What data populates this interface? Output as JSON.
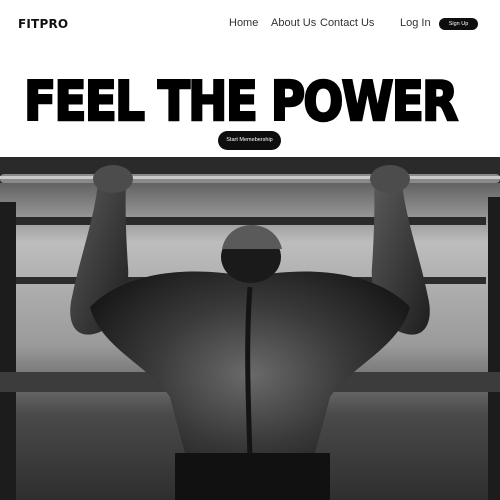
{
  "header": {
    "logo": "FITPRO",
    "nav": {
      "home": "Home",
      "about": "About Us",
      "contact": "Contact Us",
      "login": "Log In",
      "signup": "Sign Up"
    }
  },
  "hero": {
    "title": "FEEL THE POWER",
    "cta": "Start Memebership"
  },
  "colors": {
    "primary": "#0e0e0e",
    "background": "#ffffff"
  }
}
